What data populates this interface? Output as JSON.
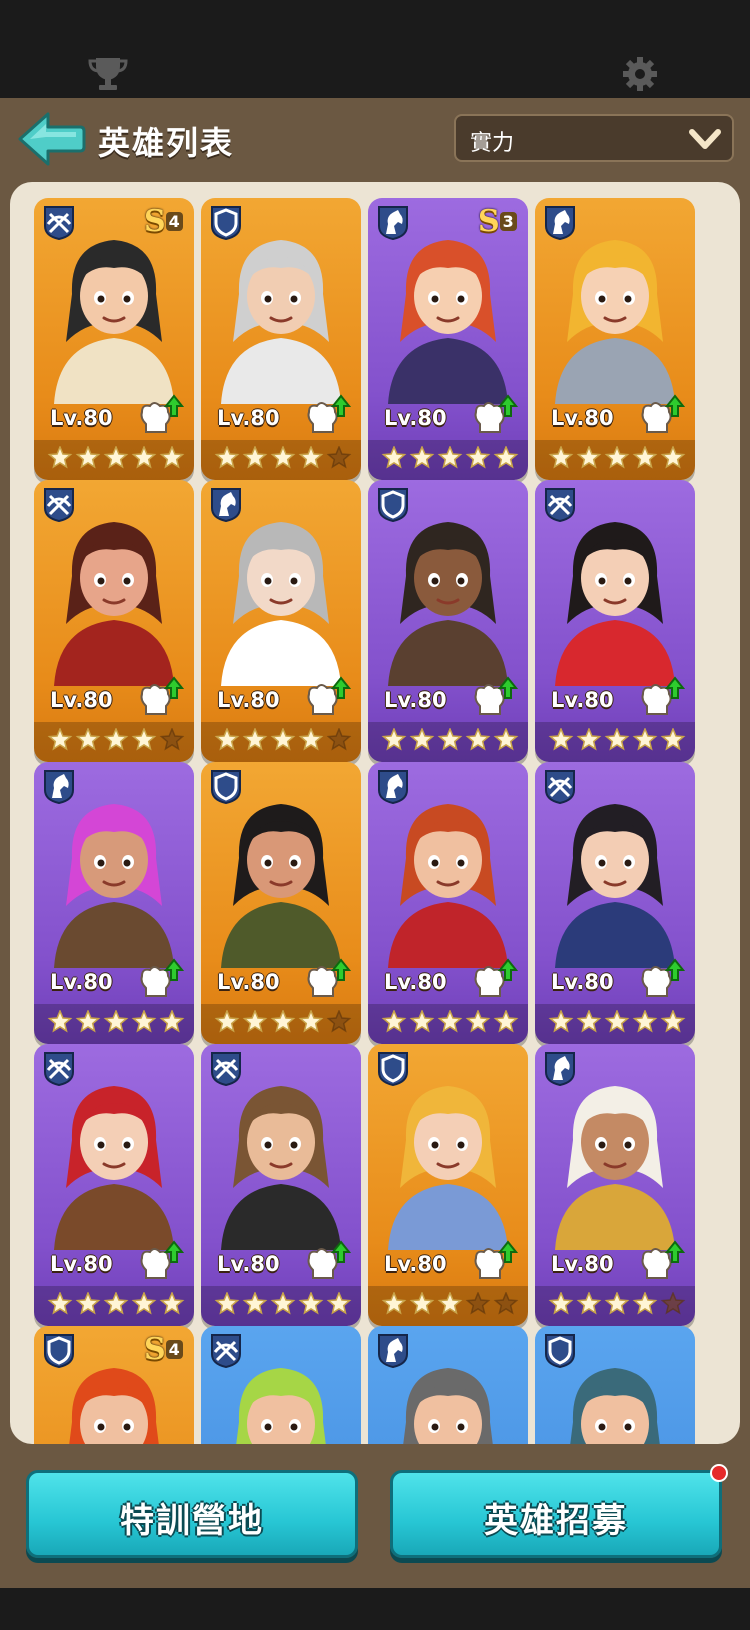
{
  "header": {
    "title": "英雄列表",
    "sort_label": "實力"
  },
  "buttons": {
    "training": "特訓營地",
    "recruit": "英雄招募"
  },
  "colors": {
    "gold_card": "#e88c1a",
    "purple_card": "#8351cc",
    "blue_card": "#3f88dc",
    "button": "#27c6d4",
    "badge": "#e52a2a"
  },
  "heroes": [
    {
      "role": "crossbow-icon",
      "bg": "gold",
      "rank": "S",
      "rank_num": "4",
      "level": "Lv.80",
      "stars": 5,
      "hair": "#2a2a2a",
      "skin": "#f3c9a8",
      "outfit": "#f0e2c4"
    },
    {
      "role": "shield-icon",
      "bg": "gold",
      "rank": "",
      "rank_num": "",
      "level": "Lv.80",
      "stars": 4,
      "hair": "#cfcfcf",
      "skin": "#f1cdb2",
      "outfit": "#e9e9e9"
    },
    {
      "role": "horse-icon",
      "bg": "purple",
      "rank": "S",
      "rank_num": "3",
      "level": "Lv.80",
      "stars": 5,
      "hair": "#d9502a",
      "skin": "#f6cfb0",
      "outfit": "#3a3168"
    },
    {
      "role": "horse-icon",
      "bg": "gold",
      "rank": "",
      "rank_num": "",
      "level": "Lv.80",
      "stars": 5,
      "hair": "#f2b530",
      "skin": "#f6d1b4",
      "outfit": "#9aa4b3"
    },
    {
      "role": "crossbow-icon",
      "bg": "gold",
      "rank": "",
      "rank_num": "",
      "level": "Lv.80",
      "stars": 4,
      "hair": "#5a2218",
      "skin": "#e7a58a",
      "outfit": "#a3241e"
    },
    {
      "role": "horse-icon",
      "bg": "gold",
      "rank": "",
      "rank_num": "",
      "level": "Lv.80",
      "stars": 4,
      "hair": "#b8b8b8",
      "skin": "#f2d9c8",
      "outfit": "#ffffff"
    },
    {
      "role": "shield-icon",
      "bg": "purple",
      "rank": "",
      "rank_num": "",
      "level": "Lv.80",
      "stars": 5,
      "hair": "#2f2620",
      "skin": "#8a5a3c",
      "outfit": "#5a4030"
    },
    {
      "role": "crossbow-icon",
      "bg": "purple",
      "rank": "",
      "rank_num": "",
      "level": "Lv.80",
      "stars": 5,
      "hair": "#1f1a1a",
      "skin": "#f4cfb6",
      "outfit": "#d8282e"
    },
    {
      "role": "horse-icon",
      "bg": "purple",
      "rank": "",
      "rank_num": "",
      "level": "Lv.80",
      "stars": 5,
      "hair": "#d446d6",
      "skin": "#d79a7a",
      "outfit": "#6a4a30"
    },
    {
      "role": "shield-icon",
      "bg": "gold",
      "rank": "",
      "rank_num": "",
      "level": "Lv.80",
      "stars": 4,
      "hair": "#1e1b1b",
      "skin": "#d99877",
      "outfit": "#4f5a2a"
    },
    {
      "role": "horse-icon",
      "bg": "purple",
      "rank": "",
      "rank_num": "",
      "level": "Lv.80",
      "stars": 5,
      "hair": "#c84a22",
      "skin": "#f0c0a0",
      "outfit": "#c0242a"
    },
    {
      "role": "crossbow-icon",
      "bg": "purple",
      "rank": "",
      "rank_num": "",
      "level": "Lv.80",
      "stars": 5,
      "hair": "#221e24",
      "skin": "#f3cdb4",
      "outfit": "#2b3b7a"
    },
    {
      "role": "crossbow-icon",
      "bg": "purple",
      "rank": "",
      "rank_num": "",
      "level": "Lv.80",
      "stars": 5,
      "hair": "#c8232a",
      "skin": "#f4cfb6",
      "outfit": "#7a4a2a"
    },
    {
      "role": "crossbow-icon",
      "bg": "purple",
      "rank": "",
      "rank_num": "",
      "level": "Lv.80",
      "stars": 5,
      "hair": "#7a5534",
      "skin": "#e9bb98",
      "outfit": "#2a2a2a"
    },
    {
      "role": "shield-icon",
      "bg": "gold",
      "rank": "",
      "rank_num": "",
      "level": "Lv.80",
      "stars": 3,
      "hair": "#f0b63a",
      "skin": "#f4cfb6",
      "outfit": "#7a9ad6"
    },
    {
      "role": "horse-icon",
      "bg": "purple",
      "rank": "",
      "rank_num": "",
      "level": "Lv.80",
      "stars": 4,
      "hair": "#f3efe6",
      "skin": "#c48a64",
      "outfit": "#d9a63a"
    },
    {
      "role": "shield-icon",
      "bg": "gold",
      "rank": "S",
      "rank_num": "4",
      "level": "",
      "stars": 0,
      "hair": "#e04a1a",
      "skin": "#f0c0a0",
      "outfit": "#d9a63a"
    },
    {
      "role": "crossbow-icon",
      "bg": "blue",
      "rank": "",
      "rank_num": "",
      "level": "",
      "stars": 0,
      "hair": "#a6d646",
      "skin": "#f0c0a0",
      "outfit": "#5a6a3a"
    },
    {
      "role": "horse-icon",
      "bg": "blue",
      "rank": "",
      "rank_num": "",
      "level": "",
      "stars": 0,
      "hair": "#6a6a6a",
      "skin": "#f0c0a0",
      "outfit": "#5a5a5a"
    },
    {
      "role": "shield-icon",
      "bg": "blue",
      "rank": "",
      "rank_num": "",
      "level": "",
      "stars": 0,
      "hair": "#3a6a7a",
      "skin": "#f0c0a0",
      "outfit": "#b48a5a"
    }
  ]
}
